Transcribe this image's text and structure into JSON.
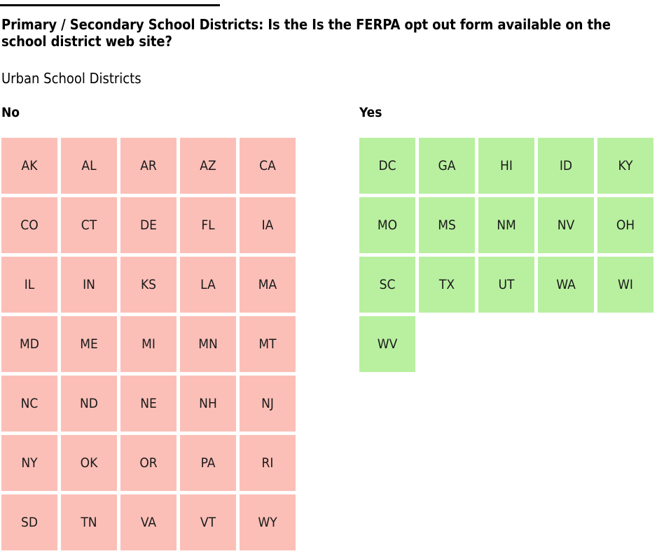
{
  "header": {
    "rule": true,
    "title": "Primary / Secondary School Districts: Is the Is the FERPA opt out form available on the school district web site?",
    "subtitle": "Urban School Districts"
  },
  "colors": {
    "no_cell_bg": "#fbbfb7",
    "yes_cell_bg": "#b9f0a0",
    "text": "#1a1a1a",
    "rule": "#000000",
    "page_bg": "#ffffff"
  },
  "groups": [
    {
      "key": "no",
      "label": "No",
      "color": "#fbbfb7",
      "count": 35,
      "items": [
        "AK",
        "AL",
        "AR",
        "AZ",
        "CA",
        "CO",
        "CT",
        "DE",
        "FL",
        "IA",
        "IL",
        "IN",
        "KS",
        "LA",
        "MA",
        "MD",
        "ME",
        "MI",
        "MN",
        "MT",
        "NC",
        "ND",
        "NE",
        "NH",
        "NJ",
        "NY",
        "OK",
        "OR",
        "PA",
        "RI",
        "SD",
        "TN",
        "VA",
        "VT",
        "WY"
      ]
    },
    {
      "key": "yes",
      "label": "Yes",
      "color": "#b9f0a0",
      "count": 16,
      "items": [
        "DC",
        "GA",
        "HI",
        "ID",
        "KY",
        "MO",
        "MS",
        "NM",
        "NV",
        "OH",
        "SC",
        "TX",
        "UT",
        "WA",
        "WI",
        "WV"
      ]
    }
  ],
  "chart_data": {
    "type": "table",
    "title": "Primary / Secondary School Districts: Is the Is the FERPA opt out form available on the school district web site?",
    "subtitle": "Urban School Districts",
    "categories": [
      "No",
      "Yes"
    ],
    "values": [
      35,
      16
    ],
    "ylabel": "",
    "xlabel": "",
    "legend": [
      "No",
      "Yes"
    ],
    "cells": {
      "No": [
        "AK",
        "AL",
        "AR",
        "AZ",
        "CA",
        "CO",
        "CT",
        "DE",
        "FL",
        "IA",
        "IL",
        "IN",
        "KS",
        "LA",
        "MA",
        "MD",
        "ME",
        "MI",
        "MN",
        "MT",
        "NC",
        "ND",
        "NE",
        "NH",
        "NJ",
        "NY",
        "OK",
        "OR",
        "PA",
        "RI",
        "SD",
        "TN",
        "VA",
        "VT",
        "WY"
      ],
      "Yes": [
        "DC",
        "GA",
        "HI",
        "ID",
        "KY",
        "MO",
        "MS",
        "NM",
        "NV",
        "OH",
        "SC",
        "TX",
        "UT",
        "WA",
        "WI",
        "WV"
      ]
    },
    "columns_per_row": 5
  }
}
